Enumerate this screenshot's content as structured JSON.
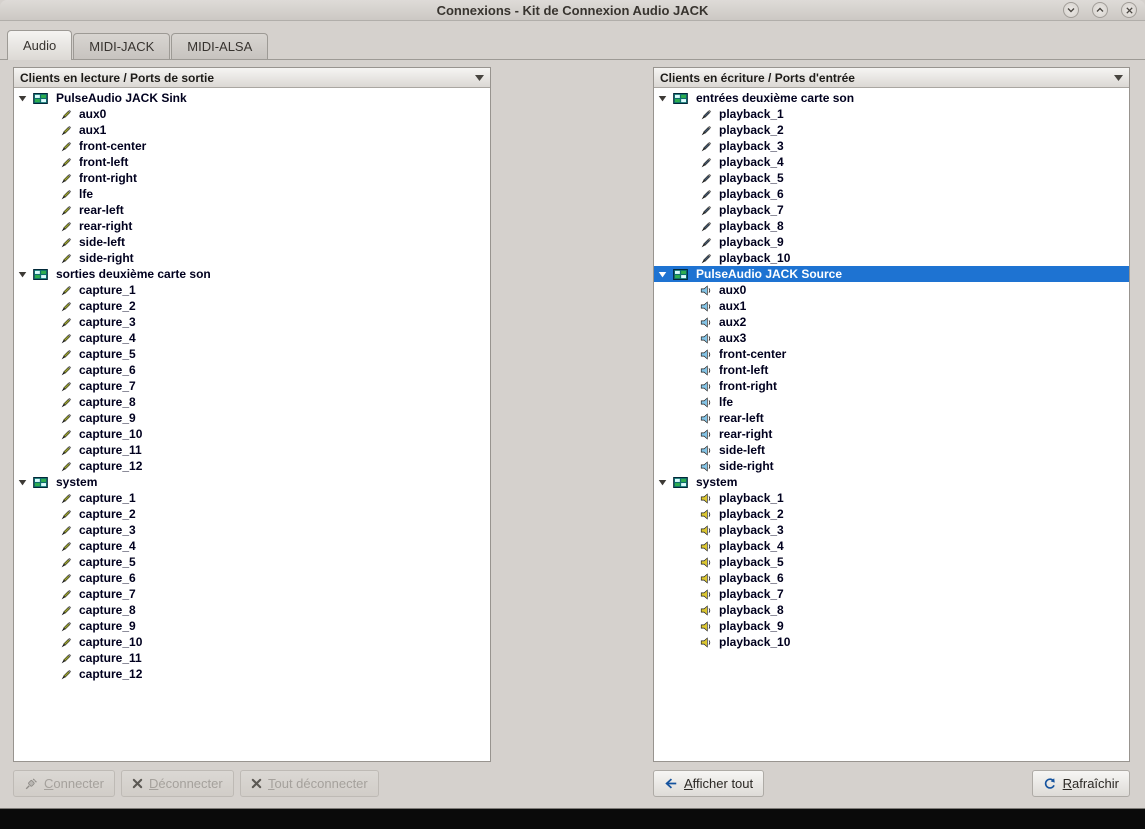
{
  "window": {
    "title": "Connexions - Kit de Connexion Audio JACK"
  },
  "tabs": [
    {
      "label": "Audio",
      "active": true
    },
    {
      "label": "MIDI-JACK",
      "active": false
    },
    {
      "label": "MIDI-ALSA",
      "active": false
    }
  ],
  "left_panel": {
    "header": "Clients en lecture / Ports de sortie",
    "clients": [
      {
        "name": "PulseAudio JACK Sink",
        "icon": "client-icon",
        "port_icon": "audio-out-pen",
        "expanded": true,
        "selected": false,
        "ports": [
          "aux0",
          "aux1",
          "front-center",
          "front-left",
          "front-right",
          "lfe",
          "rear-left",
          "rear-right",
          "side-left",
          "side-right"
        ]
      },
      {
        "name": "sorties deuxième carte son",
        "icon": "client-icon",
        "port_icon": "audio-out-pen",
        "expanded": true,
        "selected": false,
        "ports": [
          "capture_1",
          "capture_2",
          "capture_3",
          "capture_4",
          "capture_5",
          "capture_6",
          "capture_7",
          "capture_8",
          "capture_9",
          "capture_10",
          "capture_11",
          "capture_12"
        ]
      },
      {
        "name": "system",
        "icon": "client-icon",
        "port_icon": "audio-out-pen",
        "expanded": true,
        "selected": false,
        "ports": [
          "capture_1",
          "capture_2",
          "capture_3",
          "capture_4",
          "capture_5",
          "capture_6",
          "capture_7",
          "capture_8",
          "capture_9",
          "capture_10",
          "capture_11",
          "capture_12"
        ]
      }
    ]
  },
  "right_panel": {
    "header": "Clients en écriture / Ports d'entrée",
    "clients": [
      {
        "name": "entrées deuxième carte son",
        "icon": "client-icon",
        "port_icon": "audio-in-pen",
        "expanded": true,
        "selected": false,
        "ports": [
          "playback_1",
          "playback_2",
          "playback_3",
          "playback_4",
          "playback_5",
          "playback_6",
          "playback_7",
          "playback_8",
          "playback_9",
          "playback_10"
        ]
      },
      {
        "name": "PulseAudio JACK Source",
        "icon": "client-icon",
        "port_icon": "audio-in-plug-blue",
        "expanded": true,
        "selected": true,
        "ports": [
          "aux0",
          "aux1",
          "aux2",
          "aux3",
          "front-center",
          "front-left",
          "front-right",
          "lfe",
          "rear-left",
          "rear-right",
          "side-left",
          "side-right"
        ]
      },
      {
        "name": "system",
        "icon": "client-icon",
        "port_icon": "audio-in-plug-yellow",
        "expanded": true,
        "selected": false,
        "ports": [
          "playback_1",
          "playback_2",
          "playback_3",
          "playback_4",
          "playback_5",
          "playback_6",
          "playback_7",
          "playback_8",
          "playback_9",
          "playback_10"
        ]
      }
    ]
  },
  "buttons": {
    "connect": {
      "label": "Connecter",
      "enabled": false
    },
    "disconnect": {
      "label": "Déconnecter",
      "enabled": false
    },
    "disconnect_all": {
      "label": "Tout déconnecter",
      "enabled": false
    },
    "show_all": {
      "label": "Afficher tout",
      "enabled": true
    },
    "refresh": {
      "label": "Rafraîchir",
      "enabled": true
    }
  },
  "colors": {
    "selection": "#1e73d2",
    "tree_text": "#00001e",
    "accent_blue": "#15539e"
  }
}
